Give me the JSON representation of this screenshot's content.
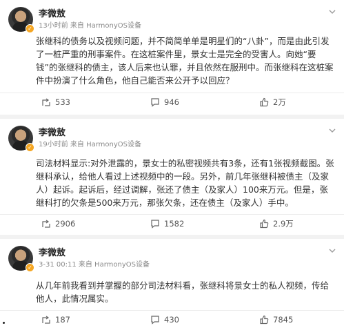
{
  "posts": [
    {
      "author": "李微敖",
      "meta": "13小时前 来自 HarmonyOS设备",
      "text": "张继科的债务以及视频问题，并不简简单单是明星们的“八卦”，而是由此引发了一桩严重的刑事案件。在这桩案件里，景女士是完全的受害人。向她“要钱”的张继科的债主，该人后来也认罪，并且依然在服刑中。而张继科在这桩案件中扮演了什么角色，他自己能否来公开予以回应？",
      "reposts": "533",
      "comments": "946",
      "likes": "2万"
    },
    {
      "author": "李微敖",
      "meta": "19小时前 来自 HarmonyOS设备",
      "text": "司法材料显示:对外泄露的，景女士的私密视频共有3条，还有1张视频截图。张继科承认，给他人看过上述视频中的一段。另外，前几年张继科被债主（及家人）起诉。起诉后，经过调解，张还了债主（及家人）100来万元。但是，张继科打的欠条是500来万元，那张欠条，还在债主（及家人）手中。",
      "reposts": "2906",
      "comments": "1582",
      "likes": "2.9万"
    },
    {
      "author": "李微敖",
      "meta": "3-31 00:11 来自 HarmonyOS设备",
      "text": "从几年前我看到并掌握的部分司法材料看，张继科将景女士的私人视频，传给他人，此情况属实。",
      "reposts": "187",
      "comments": "430",
      "likes": "7845"
    }
  ],
  "icons": {
    "repost": "repost-icon",
    "comment": "comment-icon",
    "like": "like-icon",
    "more": "chevron-down-icon",
    "verified": "verified-badge-icon"
  },
  "colors": {
    "meta_text": "#8a8a8a",
    "verified_badge": "#f5a623",
    "background": "#f2f2f2"
  }
}
